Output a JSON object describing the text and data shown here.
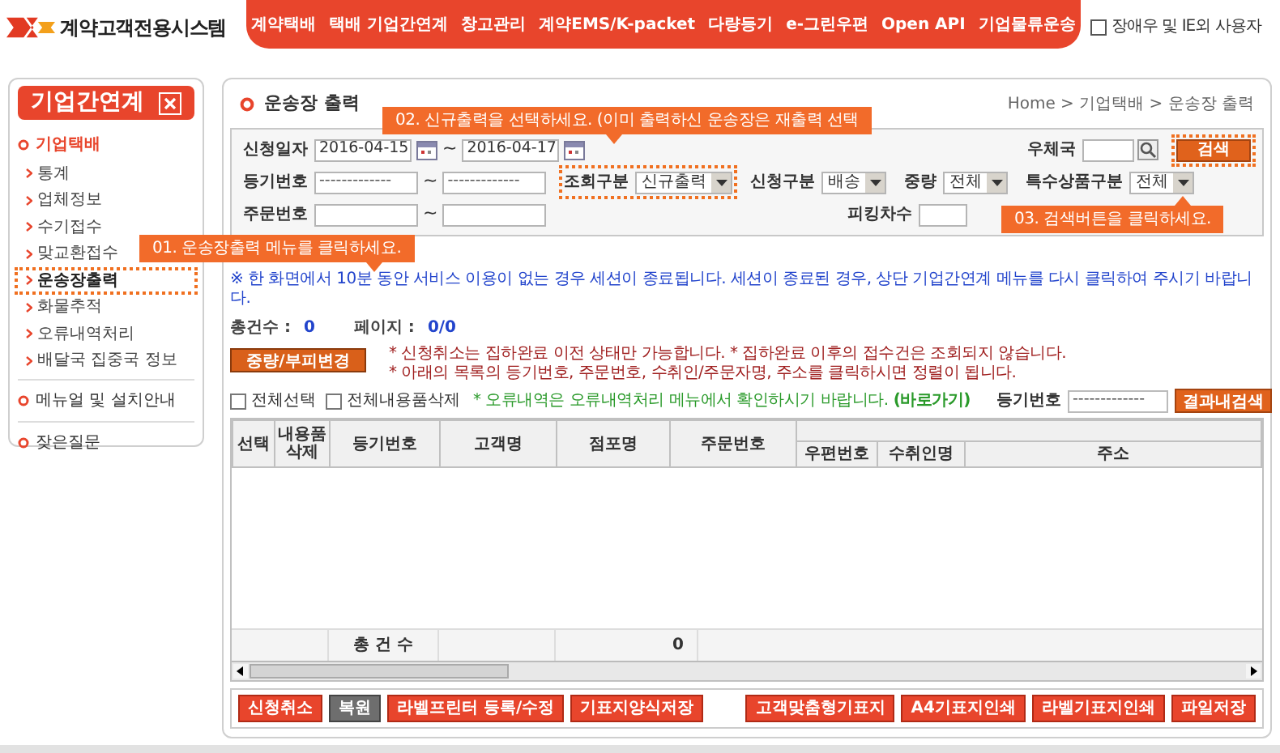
{
  "header": {
    "logo_text": "계약고객전용시스템",
    "nav": [
      "계약택배",
      "택배 기업간연계",
      "창고관리",
      "계약EMS/K-packet",
      "다량등기",
      "e-그린우편",
      "Open API",
      "기업물류운송"
    ],
    "accessibility": {
      "label": "장애우 및 IE외 사용자",
      "checked": false
    }
  },
  "sidebar": {
    "title": "기업간연계",
    "sections": [
      {
        "label": "기업택배",
        "expanded": true,
        "children": [
          {
            "label": "통계",
            "selected": false
          },
          {
            "label": "업체정보",
            "selected": false
          },
          {
            "label": "수기접수",
            "selected": false
          },
          {
            "label": "맞교환접수",
            "selected": false
          },
          {
            "label": "운송장출력",
            "selected": true
          },
          {
            "label": "화물추적",
            "selected": false
          },
          {
            "label": "오류내역처리",
            "selected": false
          },
          {
            "label": "배달국 집중국 정보",
            "selected": false
          }
        ]
      },
      {
        "label": "메뉴얼 및 설치안내",
        "expanded": false
      },
      {
        "label": "잦은질문",
        "expanded": false
      }
    ]
  },
  "page": {
    "title": "운송장 출력",
    "breadcrumb": "Home > 기업택배 > 운송장 출력"
  },
  "search_form": {
    "rows": [
      {
        "fields": [
          {
            "kind": "date_range",
            "label": "신청일자",
            "from": "2016-04-15",
            "separator": "~",
            "to": "2016-04-17",
            "highlighted": false
          },
          {
            "kind": "search_text",
            "label": "우체국",
            "highlighted": false
          }
        ]
      },
      {
        "fields": [
          {
            "kind": "text_range",
            "label": "등기번호",
            "from": "-------------",
            "separator": "~",
            "to": "-------------",
            "highlighted": false
          },
          {
            "kind": "select",
            "label": "조회구분",
            "value": "신규출력",
            "highlighted": true
          },
          {
            "kind": "select",
            "label": "신청구분",
            "value": "배송",
            "highlighted": false
          },
          {
            "kind": "select",
            "label": "중량",
            "value": "전체",
            "highlighted": false
          },
          {
            "kind": "select",
            "label": "특수상품구분",
            "value": "전체",
            "highlighted": false
          }
        ]
      },
      {
        "fields": [
          {
            "kind": "text_range",
            "label": "주문번호",
            "separator": "~",
            "highlighted": false
          },
          {
            "kind": "text",
            "label": "피킹차수",
            "highlighted": false
          }
        ]
      }
    ],
    "search_button": {
      "label": "검색",
      "highlighted": true
    }
  },
  "session_notice": "※ 한 화면에서 10분 동안 서비스 이용이 없는 경우 세션이 종료됩니다. 세션이 종료된 경우, 상단 기업간연계 메뉴를 다시 클릭하여 주시기 바랍니다.",
  "summary": [
    {
      "label": "총건수 :",
      "value": "0"
    },
    {
      "label": "페이지 :",
      "value": "0/0"
    }
  ],
  "weight_button": "중량/부피변경",
  "notices": [
    {
      "kind": "warning",
      "text": "* 신청취소는 집하완료 이전 상태만 가능합니다.  * 집하완료 이후의 접수건은 조회되지 않습니다."
    },
    {
      "kind": "warning",
      "text": "* 아래의 목록의 등기번호, 주문번호, 수취인/주문자명, 주소를 클릭하시면 정렬이 됩니다."
    },
    {
      "kind": "info",
      "text": "* 오류내역은 오류내역처리 메뉴에서 확인하시기 바랍니다.",
      "link": "(바로가기)"
    }
  ],
  "bulk_checks": [
    {
      "label": "전체선택",
      "checked": false
    },
    {
      "label": "전체내용품삭제",
      "checked": false
    }
  ],
  "result_filter": {
    "label": "등기번호",
    "value": "-------------",
    "button": "결과내검색"
  },
  "table": {
    "columns": [
      "선택",
      "내용품삭제",
      "등기번호",
      "고객명",
      "점포명",
      "주문번호"
    ],
    "group_columns": [
      "우편번호",
      "수취인명",
      "주소"
    ],
    "footer": {
      "label": "총 건 수",
      "value": "0"
    }
  },
  "actions_left": [
    {
      "label": "신청취소",
      "kind": "active"
    },
    {
      "label": "복원",
      "kind": "inactive"
    },
    {
      "label": "라벨프린터 등록/수정",
      "kind": "active"
    },
    {
      "label": "기표지양식저장",
      "kind": "active"
    }
  ],
  "actions_right": [
    {
      "label": "고객맞춤형기표지",
      "kind": "active"
    },
    {
      "label": "A4기표지인쇄",
      "kind": "active"
    },
    {
      "label": "라벨기표지인쇄",
      "kind": "active"
    },
    {
      "label": "파일저장",
      "kind": "active"
    }
  ],
  "callouts": [
    {
      "text": "01. 운송장출력 메뉴를 클릭하세요."
    },
    {
      "text": "02. 신규출력을 선택하세요. (이미 출력하신 운송장은 재출력 선택"
    },
    {
      "text": "03. 검색버튼을 클릭하세요."
    }
  ]
}
